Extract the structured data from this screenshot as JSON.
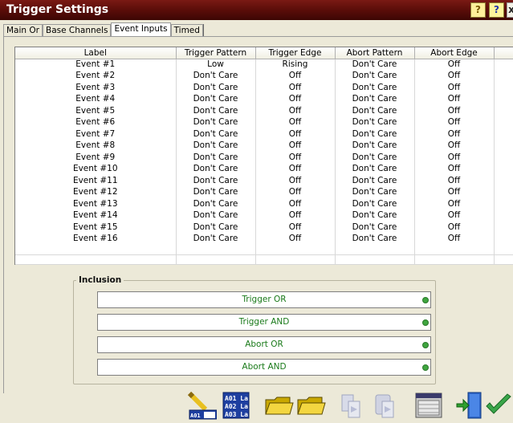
{
  "window": {
    "title": "Trigger Settings"
  },
  "titlebar_buttons": [
    "?",
    "?",
    "x"
  ],
  "tabs": [
    {
      "label": "Main Or",
      "active": false
    },
    {
      "label": "Base Channels",
      "active": false
    },
    {
      "label": "Event Inputs",
      "active": true
    },
    {
      "label": "Timed",
      "active": false
    }
  ],
  "table": {
    "columns": [
      "Label",
      "Trigger Pattern",
      "Trigger Edge",
      "Abort Pattern",
      "Abort Edge"
    ],
    "rows": [
      [
        "Event #1",
        "Low",
        "Rising",
        "Don't Care",
        "Off"
      ],
      [
        "Event #2",
        "Don't Care",
        "Off",
        "Don't Care",
        "Off"
      ],
      [
        "Event #3",
        "Don't Care",
        "Off",
        "Don't Care",
        "Off"
      ],
      [
        "Event #4",
        "Don't Care",
        "Off",
        "Don't Care",
        "Off"
      ],
      [
        "Event #5",
        "Don't Care",
        "Off",
        "Don't Care",
        "Off"
      ],
      [
        "Event #6",
        "Don't Care",
        "Off",
        "Don't Care",
        "Off"
      ],
      [
        "Event #7",
        "Don't Care",
        "Off",
        "Don't Care",
        "Off"
      ],
      [
        "Event #8",
        "Don't Care",
        "Off",
        "Don't Care",
        "Off"
      ],
      [
        "Event #9",
        "Don't Care",
        "Off",
        "Don't Care",
        "Off"
      ],
      [
        "Event #10",
        "Don't Care",
        "Off",
        "Don't Care",
        "Off"
      ],
      [
        "Event #11",
        "Don't Care",
        "Off",
        "Don't Care",
        "Off"
      ],
      [
        "Event #12",
        "Don't Care",
        "Off",
        "Don't Care",
        "Off"
      ],
      [
        "Event #13",
        "Don't Care",
        "Off",
        "Don't Care",
        "Off"
      ],
      [
        "Event #14",
        "Don't Care",
        "Off",
        "Don't Care",
        "Off"
      ],
      [
        "Event #15",
        "Don't Care",
        "Off",
        "Don't Care",
        "Off"
      ],
      [
        "Event #16",
        "Don't Care",
        "Off",
        "Don't Care",
        "Off"
      ]
    ]
  },
  "inclusion": {
    "label": "Inclusion",
    "items": [
      "Trigger OR",
      "Trigger AND",
      "Abort OR",
      "Abort AND"
    ],
    "indicator_color": "#3fa53f"
  },
  "toolbar": {
    "icons": [
      "edit-labels-icon",
      "label-list-icon",
      "open-folder-icon",
      "open-folder-icon",
      "copy-icon",
      "paste-icon",
      "display-panel-icon",
      "exit-door-icon",
      "ok-check-icon"
    ],
    "label_icon_text": [
      "A01 La",
      "A02 La",
      "A03 La"
    ],
    "edit_icon_text": "A01 La"
  }
}
